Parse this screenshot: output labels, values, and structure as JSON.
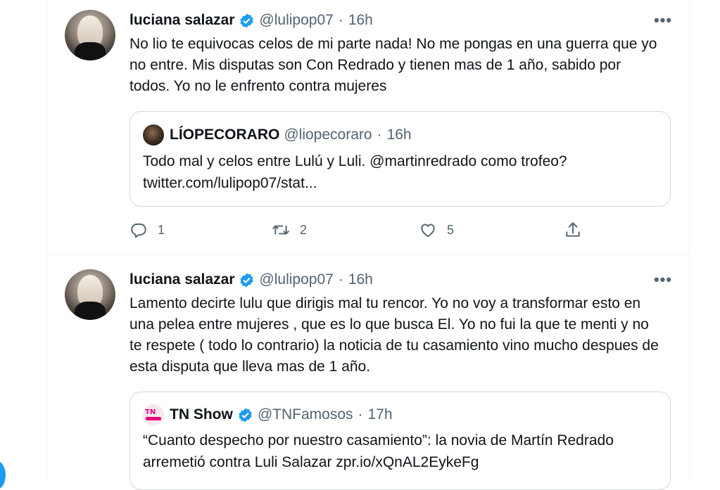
{
  "colors": {
    "accent": "#1d9bf0",
    "text": "#0f1419",
    "muted": "#536471",
    "border": "#cfd9de"
  },
  "tweets": [
    {
      "name": "luciana salazar",
      "handle": "@lulipop07",
      "dot": "·",
      "time": "16h",
      "more": "•••",
      "text": "No lio te equivocas celos de mi parte nada! No me pongas en una guerra que yo no entre. Mis disputas son Con Redrado y tienen mas de 1 año, sabido por todos. Yo no le enfrento contra mujeres",
      "quote": {
        "name": "LÍOPECORARO",
        "handle": "@liopecoraro",
        "dot": "·",
        "time": "16h",
        "text": "Todo mal y celos entre Lulú y Luli. @martinredrado como trofeo? twitter.com/lulipop07/stat..."
      },
      "actions": {
        "replies": "1",
        "retweets": "2",
        "likes": "5"
      }
    },
    {
      "name": "luciana salazar",
      "handle": "@lulipop07",
      "dot": "·",
      "time": "16h",
      "more": "•••",
      "text": "Lamento decirte lulu que dirigis mal tu rencor. Yo no voy a transformar esto en una pelea entre mujeres , que es lo que busca El. Yo no fui la que te menti y no te respete ( todo lo contrario) la noticia de tu casamiento vino mucho despues de esta disputa que lleva mas de 1 año.",
      "quote": {
        "name": "TN Show",
        "handle": "@TNFamosos",
        "dot": "·",
        "time": "17h",
        "avatar_label": "TN",
        "text": "“Cuanto despecho por nuestro casamiento”: la novia de Martín Redrado arremetió contra Luli Salazar zpr.io/xQnAL2EykeFg"
      }
    }
  ]
}
